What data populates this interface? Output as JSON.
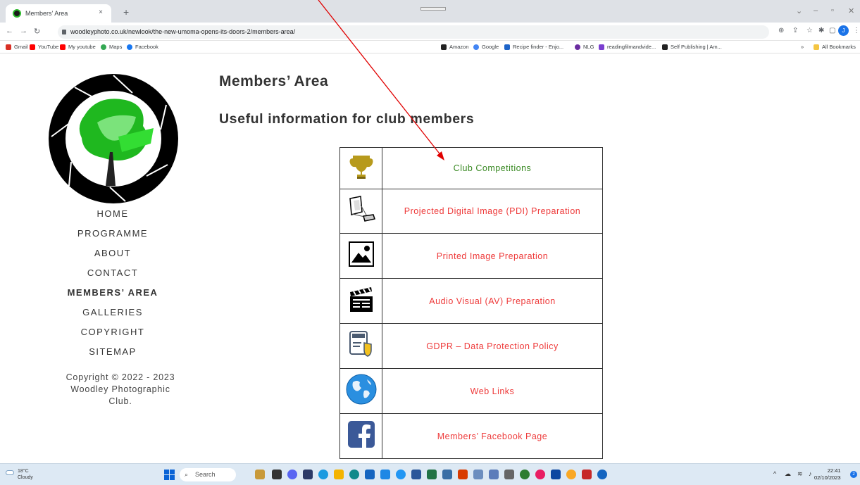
{
  "browser": {
    "tab_title": "Members' Area",
    "tab_close": "×",
    "new_tab": "+",
    "url": "woodleyphoto.co.uk/newlook/the-new-umoma-opens-its-doors-2/members-area/",
    "bookmarks": [
      "Gmail",
      "YouTube",
      "My youtube",
      "Maps",
      "Facebook",
      "Amazon",
      "Google",
      "Recipe finder - Enjo...",
      "NLG",
      "readingfilmandvide...",
      "Self Publishing | Am..."
    ],
    "bookmarks_more": "»",
    "all_bookmarks": "All Bookmarks",
    "avatar_letter": "J"
  },
  "sidebar": {
    "nav": [
      {
        "label": "HOME"
      },
      {
        "label": "PROGRAMME"
      },
      {
        "label": "ABOUT"
      },
      {
        "label": "CONTACT"
      },
      {
        "label": "MEMBERS’ AREA",
        "active": true
      },
      {
        "label": "GALLERIES"
      },
      {
        "label": "COPYRIGHT"
      },
      {
        "label": "SITEMAP"
      }
    ],
    "copyright_line1": "Copyright © 2022 - 2023",
    "copyright_line2": "Woodley Photographic",
    "copyright_line3": "Club."
  },
  "main": {
    "title": "Members’ Area",
    "subtitle": "Useful information for club members",
    "links": [
      {
        "label": "Club Competitions",
        "icon": "trophy-icon"
      },
      {
        "label": "Projected Digital Image (PDI) Preparation",
        "icon": "projector-icon"
      },
      {
        "label": "Printed Image Preparation",
        "icon": "image-icon"
      },
      {
        "label": "Audio Visual (AV) Preparation",
        "icon": "clapperboard-icon"
      },
      {
        "label": "GDPR – Data Protection Policy",
        "icon": "gdpr-shield-icon"
      },
      {
        "label": "Web Links",
        "icon": "globe-icon"
      },
      {
        "label": "Members’ Facebook Page",
        "icon": "facebook-icon"
      }
    ]
  },
  "taskbar": {
    "temperature": "18°C",
    "weather": "Cloudy",
    "search_placeholder": "Search",
    "time": "22:41",
    "date": "02/10/2023",
    "notification_count": "2"
  },
  "colors": {
    "link_red": "#ee3a3a",
    "link_green": "#3a8a24",
    "annotation_red": "#e00000"
  }
}
